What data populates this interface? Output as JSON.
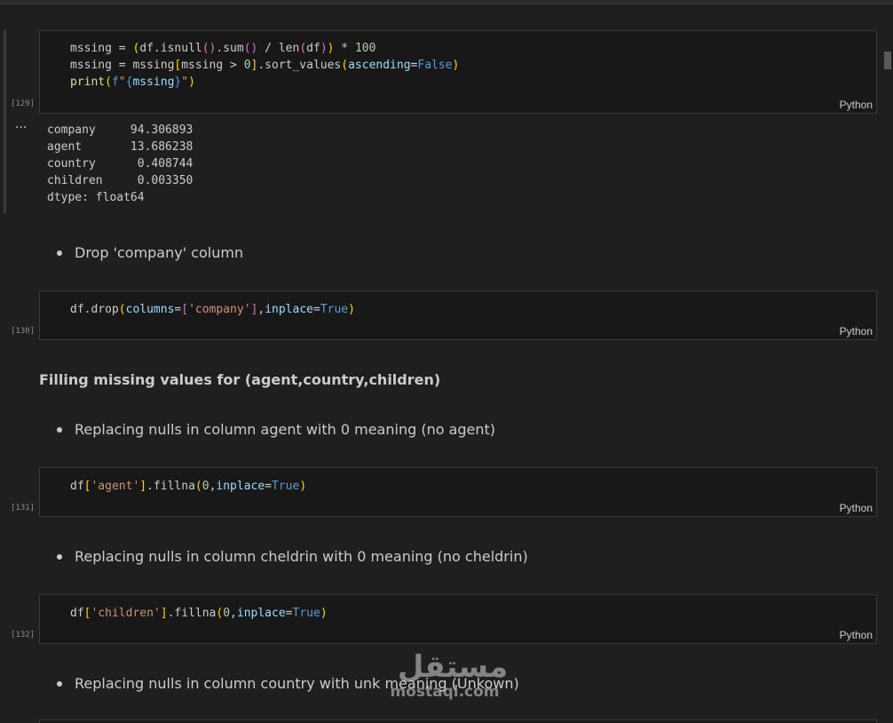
{
  "language_label": "Python",
  "cells": [
    {
      "exec_count": "[129]"
    },
    {
      "exec_count": "[130]"
    },
    {
      "exec_count": "[131]"
    },
    {
      "exec_count": "[132]"
    }
  ],
  "output": {
    "ellipsis": "···",
    "lines": [
      "company     94.306893",
      "agent       13.686238",
      "country      0.408744",
      "children     0.003350",
      "dtype: float64"
    ]
  },
  "markdown": {
    "bullet_drop": "Drop 'company' column",
    "heading_fill": "Filling missing values for (agent,country,children)",
    "bullet_agent": "Replacing nulls in column agent with 0 meaning (no agent)",
    "bullet_children": "Replacing nulls in column cheldrin with 0 meaning (no cheldrin)",
    "bullet_country": "Replacing nulls in column country with unk meaning (Unkown)"
  },
  "watermark": {
    "arabic": "مستقل",
    "latin": "mostaql.com"
  }
}
